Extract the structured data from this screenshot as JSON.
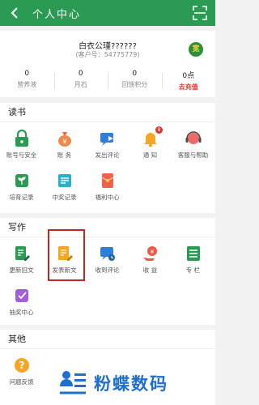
{
  "header": {
    "title": "个人中心",
    "back_icon": "back-arrow-icon",
    "scan_icon": "scan-icon"
  },
  "profile": {
    "name": "白衣公瑾??????",
    "customer_no": "(客户号：54775779)",
    "badge_text": "宽",
    "stats": [
      {
        "value": "0",
        "label": "营养液"
      },
      {
        "value": "0",
        "label": "月石"
      },
      {
        "value": "0",
        "label": "回馈积分"
      },
      {
        "value": "0点",
        "label": "去充值"
      }
    ]
  },
  "reading": {
    "title": "读书",
    "items": [
      {
        "label": "账号与安全",
        "icon": "lock-icon"
      },
      {
        "label": "账  务",
        "icon": "money-bag-icon"
      },
      {
        "label": "发出评论",
        "icon": "comment-send-icon"
      },
      {
        "label": "通  知",
        "icon": "bell-icon",
        "badge": "8"
      },
      {
        "label": "客服与帮助",
        "icon": "headset-icon"
      },
      {
        "label": "培育记录",
        "icon": "sprout-icon"
      },
      {
        "label": "中奖记录",
        "icon": "prize-icon"
      },
      {
        "label": "福利中心",
        "icon": "red-packet-icon"
      }
    ]
  },
  "writing": {
    "title": "写作",
    "items": [
      {
        "label": "更新旧文",
        "icon": "edit-doc-icon"
      },
      {
        "label": "发表新文",
        "icon": "new-doc-icon"
      },
      {
        "label": "收到评论",
        "icon": "comment-receive-icon"
      },
      {
        "label": "收  益",
        "icon": "income-icon"
      },
      {
        "label": "专  栏",
        "icon": "column-icon"
      },
      {
        "label": "抽奖中心",
        "icon": "lottery-icon"
      }
    ]
  },
  "other": {
    "title": "其他",
    "items": [
      {
        "label": "问题反馈",
        "icon": "question-icon"
      }
    ]
  },
  "watermark": {
    "text": "粉蝶数码"
  },
  "colors": {
    "brand": "#2b9a52",
    "accent_red": "#e0322c",
    "watermark_blue": "#1f6fd0"
  }
}
